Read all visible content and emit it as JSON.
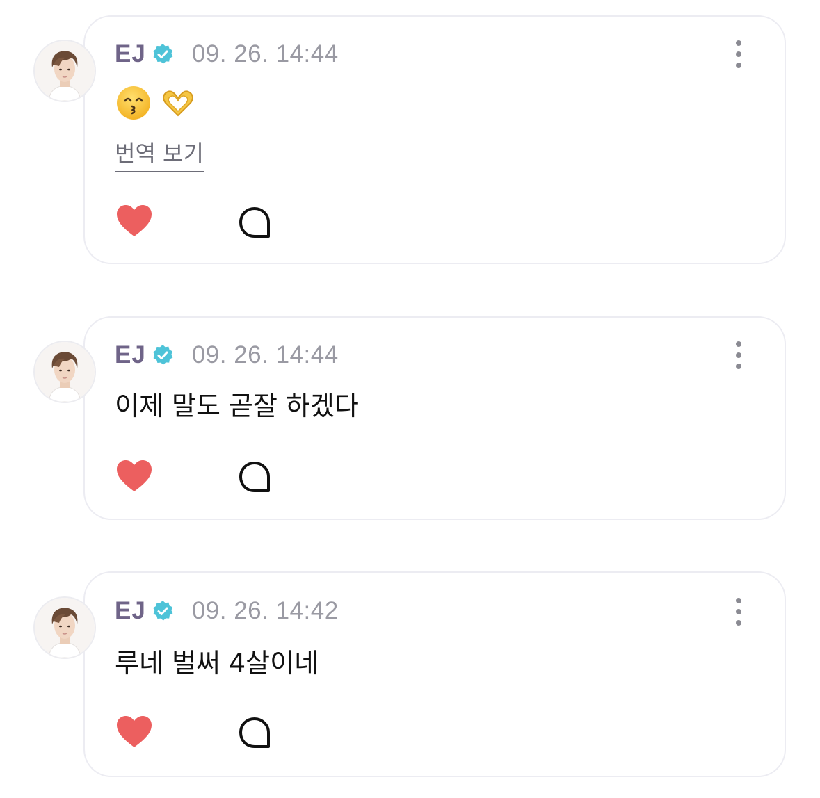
{
  "colors": {
    "author": "#6f6488",
    "timestamp": "#9a9aa3",
    "verified_badge": "#4ec3d8",
    "like_heart": "#ec5f5f",
    "card_border": "#ececf2"
  },
  "posts": [
    {
      "author": "EJ",
      "verified": true,
      "timestamp": "09. 26. 14:44",
      "text": "",
      "emojis": [
        "kissing-face-with-smiling-eyes",
        "heart-hands"
      ],
      "translate_label": "번역 보기",
      "icons": [
        "more-vertical-icon",
        "heart-icon",
        "comment-icon"
      ]
    },
    {
      "author": "EJ",
      "verified": true,
      "timestamp": "09. 26. 14:44",
      "text": "이제 말도 곧잘 하겠다",
      "icons": [
        "more-vertical-icon",
        "heart-icon",
        "comment-icon"
      ]
    },
    {
      "author": "EJ",
      "verified": true,
      "timestamp": "09. 26. 14:42",
      "text": "루네 벌써 4살이네",
      "icons": [
        "more-vertical-icon",
        "heart-icon",
        "comment-icon"
      ]
    }
  ]
}
